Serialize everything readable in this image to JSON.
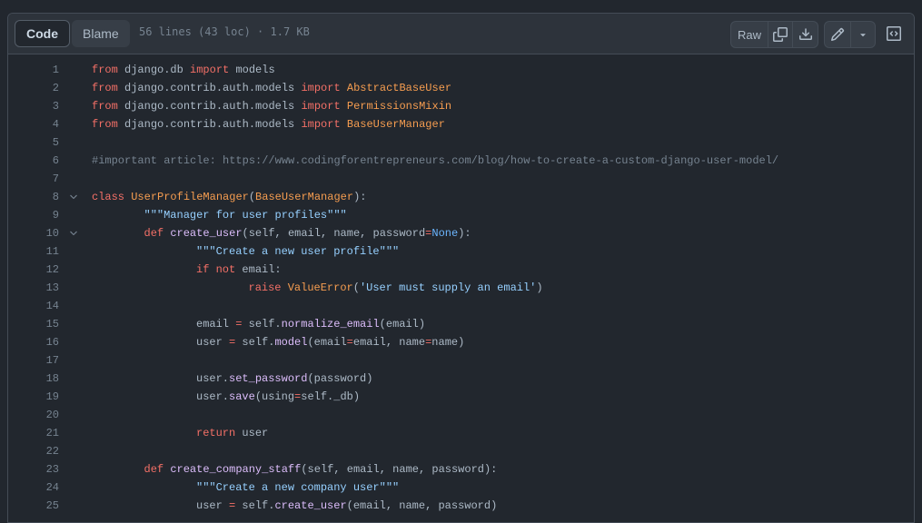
{
  "tabs": {
    "code": "Code",
    "blame": "Blame"
  },
  "file_info": "56 lines (43 loc) · 1.7 KB",
  "toolbar": {
    "raw": "Raw",
    "icons": [
      "copy-icon",
      "download-icon",
      "pencil-icon",
      "triangle-down-icon",
      "code-square-icon"
    ]
  },
  "colors": {
    "background": "#22272e",
    "header": "#2d333b",
    "keyword": "#f47067",
    "function": "#dcbdfb",
    "class": "#f69d50",
    "string": "#96d0ff",
    "comment": "#768390",
    "constant": "#6cb6ff"
  },
  "lines": [
    {
      "n": "1",
      "fold": false,
      "indent": 0,
      "tokens": [
        [
          "from",
          "kw"
        ],
        [
          " django.db ",
          ""
        ],
        [
          "import",
          "kw"
        ],
        [
          " models",
          ""
        ]
      ]
    },
    {
      "n": "2",
      "fold": false,
      "indent": 0,
      "tokens": [
        [
          "from",
          "kw"
        ],
        [
          " django.contrib.auth.models ",
          ""
        ],
        [
          "import",
          "kw"
        ],
        [
          " ",
          ""
        ],
        [
          "AbstractBaseUser",
          "cl"
        ]
      ]
    },
    {
      "n": "3",
      "fold": false,
      "indent": 0,
      "tokens": [
        [
          "from",
          "kw"
        ],
        [
          " django.contrib.auth.models ",
          ""
        ],
        [
          "import",
          "kw"
        ],
        [
          " ",
          ""
        ],
        [
          "PermissionsMixin",
          "cl"
        ]
      ]
    },
    {
      "n": "4",
      "fold": false,
      "indent": 0,
      "tokens": [
        [
          "from",
          "kw"
        ],
        [
          " django.contrib.auth.models ",
          ""
        ],
        [
          "import",
          "kw"
        ],
        [
          " ",
          ""
        ],
        [
          "BaseUserManager",
          "cl"
        ]
      ]
    },
    {
      "n": "5",
      "fold": false,
      "indent": 0,
      "tokens": []
    },
    {
      "n": "6",
      "fold": false,
      "indent": 0,
      "tokens": [
        [
          "#important article: https://www.codingforentrepreneurs.com/blog/how-to-create-a-custom-django-user-model/",
          "cm"
        ]
      ]
    },
    {
      "n": "7",
      "fold": false,
      "indent": 0,
      "tokens": []
    },
    {
      "n": "8",
      "fold": true,
      "indent": 0,
      "tokens": [
        [
          "class",
          "kw"
        ],
        [
          " ",
          ""
        ],
        [
          "UserProfileManager",
          "cl"
        ],
        [
          "(",
          ""
        ],
        [
          "BaseUserManager",
          "cl"
        ],
        [
          "):",
          ""
        ]
      ]
    },
    {
      "n": "9",
      "fold": false,
      "indent": 1,
      "tokens": [
        [
          "\"\"\"Manager for user profiles\"\"\"",
          "str"
        ]
      ]
    },
    {
      "n": "10",
      "fold": true,
      "indent": 1,
      "tokens": [
        [
          "def",
          "kw"
        ],
        [
          " ",
          ""
        ],
        [
          "create_user",
          "fn"
        ],
        [
          "(self, email, name, password",
          ""
        ],
        [
          "=",
          "kw"
        ],
        [
          "None",
          "cn"
        ],
        [
          "):",
          ""
        ]
      ]
    },
    {
      "n": "11",
      "fold": false,
      "indent": 2,
      "tokens": [
        [
          "\"\"\"Create a new user profile\"\"\"",
          "str"
        ]
      ]
    },
    {
      "n": "12",
      "fold": false,
      "indent": 2,
      "tokens": [
        [
          "if",
          "kw"
        ],
        [
          " ",
          ""
        ],
        [
          "not",
          "kw"
        ],
        [
          " email:",
          ""
        ]
      ]
    },
    {
      "n": "13",
      "fold": false,
      "indent": 3,
      "tokens": [
        [
          "raise",
          "kw"
        ],
        [
          " ",
          ""
        ],
        [
          "ValueError",
          "cl"
        ],
        [
          "(",
          ""
        ],
        [
          "'User must supply an email'",
          "str"
        ],
        [
          ")",
          ""
        ]
      ]
    },
    {
      "n": "14",
      "fold": false,
      "indent": 0,
      "tokens": []
    },
    {
      "n": "15",
      "fold": false,
      "indent": 2,
      "tokens": [
        [
          "email ",
          ""
        ],
        [
          "=",
          "kw"
        ],
        [
          " self.",
          ""
        ],
        [
          "normalize_email",
          "fn"
        ],
        [
          "(email)",
          ""
        ]
      ]
    },
    {
      "n": "16",
      "fold": false,
      "indent": 2,
      "tokens": [
        [
          "user ",
          ""
        ],
        [
          "=",
          "kw"
        ],
        [
          " self.",
          ""
        ],
        [
          "model",
          "fn"
        ],
        [
          "(email",
          ""
        ],
        [
          "=",
          "kw"
        ],
        [
          "email, name",
          ""
        ],
        [
          "=",
          "kw"
        ],
        [
          "name)",
          ""
        ]
      ]
    },
    {
      "n": "17",
      "fold": false,
      "indent": 0,
      "tokens": []
    },
    {
      "n": "18",
      "fold": false,
      "indent": 2,
      "tokens": [
        [
          "user.",
          ""
        ],
        [
          "set_password",
          "fn"
        ],
        [
          "(password)",
          ""
        ]
      ]
    },
    {
      "n": "19",
      "fold": false,
      "indent": 2,
      "tokens": [
        [
          "user.",
          ""
        ],
        [
          "save",
          "fn"
        ],
        [
          "(using",
          ""
        ],
        [
          "=",
          "kw"
        ],
        [
          "self._db)",
          ""
        ]
      ]
    },
    {
      "n": "20",
      "fold": false,
      "indent": 0,
      "tokens": []
    },
    {
      "n": "21",
      "fold": false,
      "indent": 2,
      "tokens": [
        [
          "return",
          "kw"
        ],
        [
          " user",
          ""
        ]
      ]
    },
    {
      "n": "22",
      "fold": false,
      "indent": 0,
      "tokens": []
    },
    {
      "n": "23",
      "fold": false,
      "indent": 1,
      "tokens": [
        [
          "def",
          "kw"
        ],
        [
          " ",
          ""
        ],
        [
          "create_company_staff",
          "fn"
        ],
        [
          "(self, email, name, password):",
          ""
        ]
      ]
    },
    {
      "n": "24",
      "fold": false,
      "indent": 2,
      "tokens": [
        [
          "\"\"\"Create a new company user\"\"\"",
          "str"
        ]
      ]
    },
    {
      "n": "25",
      "fold": false,
      "indent": 2,
      "tokens": [
        [
          "user ",
          ""
        ],
        [
          "=",
          "kw"
        ],
        [
          " self.",
          ""
        ],
        [
          "create_user",
          "fn"
        ],
        [
          "(email, name, password)",
          ""
        ]
      ]
    }
  ]
}
